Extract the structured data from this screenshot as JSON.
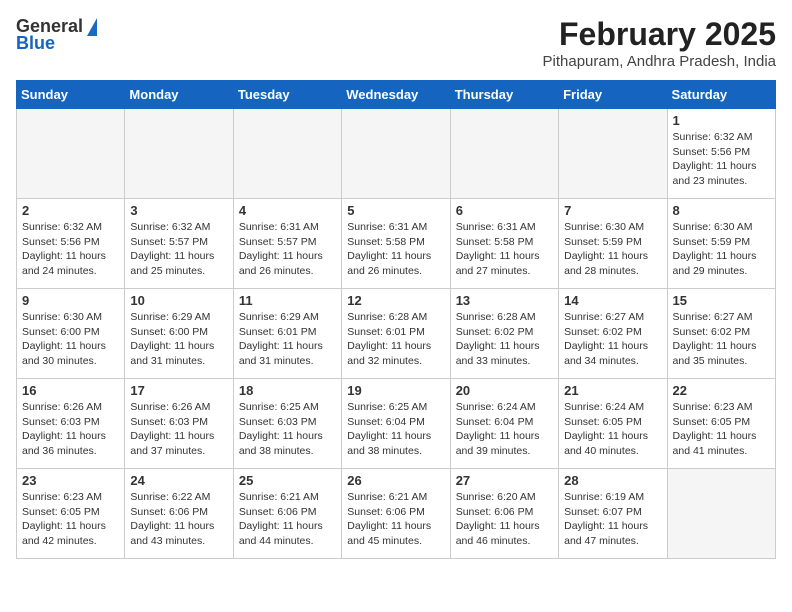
{
  "logo": {
    "line1": "General",
    "line2": "Blue"
  },
  "title": "February 2025",
  "location": "Pithapuram, Andhra Pradesh, India",
  "headers": [
    "Sunday",
    "Monday",
    "Tuesday",
    "Wednesday",
    "Thursday",
    "Friday",
    "Saturday"
  ],
  "weeks": [
    [
      {
        "day": "",
        "info": ""
      },
      {
        "day": "",
        "info": ""
      },
      {
        "day": "",
        "info": ""
      },
      {
        "day": "",
        "info": ""
      },
      {
        "day": "",
        "info": ""
      },
      {
        "day": "",
        "info": ""
      },
      {
        "day": "1",
        "info": "Sunrise: 6:32 AM\nSunset: 5:56 PM\nDaylight: 11 hours and 23 minutes."
      }
    ],
    [
      {
        "day": "2",
        "info": "Sunrise: 6:32 AM\nSunset: 5:56 PM\nDaylight: 11 hours and 24 minutes."
      },
      {
        "day": "3",
        "info": "Sunrise: 6:32 AM\nSunset: 5:57 PM\nDaylight: 11 hours and 25 minutes."
      },
      {
        "day": "4",
        "info": "Sunrise: 6:31 AM\nSunset: 5:57 PM\nDaylight: 11 hours and 26 minutes."
      },
      {
        "day": "5",
        "info": "Sunrise: 6:31 AM\nSunset: 5:58 PM\nDaylight: 11 hours and 26 minutes."
      },
      {
        "day": "6",
        "info": "Sunrise: 6:31 AM\nSunset: 5:58 PM\nDaylight: 11 hours and 27 minutes."
      },
      {
        "day": "7",
        "info": "Sunrise: 6:30 AM\nSunset: 5:59 PM\nDaylight: 11 hours and 28 minutes."
      },
      {
        "day": "8",
        "info": "Sunrise: 6:30 AM\nSunset: 5:59 PM\nDaylight: 11 hours and 29 minutes."
      }
    ],
    [
      {
        "day": "9",
        "info": "Sunrise: 6:30 AM\nSunset: 6:00 PM\nDaylight: 11 hours and 30 minutes."
      },
      {
        "day": "10",
        "info": "Sunrise: 6:29 AM\nSunset: 6:00 PM\nDaylight: 11 hours and 31 minutes."
      },
      {
        "day": "11",
        "info": "Sunrise: 6:29 AM\nSunset: 6:01 PM\nDaylight: 11 hours and 31 minutes."
      },
      {
        "day": "12",
        "info": "Sunrise: 6:28 AM\nSunset: 6:01 PM\nDaylight: 11 hours and 32 minutes."
      },
      {
        "day": "13",
        "info": "Sunrise: 6:28 AM\nSunset: 6:02 PM\nDaylight: 11 hours and 33 minutes."
      },
      {
        "day": "14",
        "info": "Sunrise: 6:27 AM\nSunset: 6:02 PM\nDaylight: 11 hours and 34 minutes."
      },
      {
        "day": "15",
        "info": "Sunrise: 6:27 AM\nSunset: 6:02 PM\nDaylight: 11 hours and 35 minutes."
      }
    ],
    [
      {
        "day": "16",
        "info": "Sunrise: 6:26 AM\nSunset: 6:03 PM\nDaylight: 11 hours and 36 minutes."
      },
      {
        "day": "17",
        "info": "Sunrise: 6:26 AM\nSunset: 6:03 PM\nDaylight: 11 hours and 37 minutes."
      },
      {
        "day": "18",
        "info": "Sunrise: 6:25 AM\nSunset: 6:03 PM\nDaylight: 11 hours and 38 minutes."
      },
      {
        "day": "19",
        "info": "Sunrise: 6:25 AM\nSunset: 6:04 PM\nDaylight: 11 hours and 38 minutes."
      },
      {
        "day": "20",
        "info": "Sunrise: 6:24 AM\nSunset: 6:04 PM\nDaylight: 11 hours and 39 minutes."
      },
      {
        "day": "21",
        "info": "Sunrise: 6:24 AM\nSunset: 6:05 PM\nDaylight: 11 hours and 40 minutes."
      },
      {
        "day": "22",
        "info": "Sunrise: 6:23 AM\nSunset: 6:05 PM\nDaylight: 11 hours and 41 minutes."
      }
    ],
    [
      {
        "day": "23",
        "info": "Sunrise: 6:23 AM\nSunset: 6:05 PM\nDaylight: 11 hours and 42 minutes."
      },
      {
        "day": "24",
        "info": "Sunrise: 6:22 AM\nSunset: 6:06 PM\nDaylight: 11 hours and 43 minutes."
      },
      {
        "day": "25",
        "info": "Sunrise: 6:21 AM\nSunset: 6:06 PM\nDaylight: 11 hours and 44 minutes."
      },
      {
        "day": "26",
        "info": "Sunrise: 6:21 AM\nSunset: 6:06 PM\nDaylight: 11 hours and 45 minutes."
      },
      {
        "day": "27",
        "info": "Sunrise: 6:20 AM\nSunset: 6:06 PM\nDaylight: 11 hours and 46 minutes."
      },
      {
        "day": "28",
        "info": "Sunrise: 6:19 AM\nSunset: 6:07 PM\nDaylight: 11 hours and 47 minutes."
      },
      {
        "day": "",
        "info": ""
      }
    ]
  ]
}
